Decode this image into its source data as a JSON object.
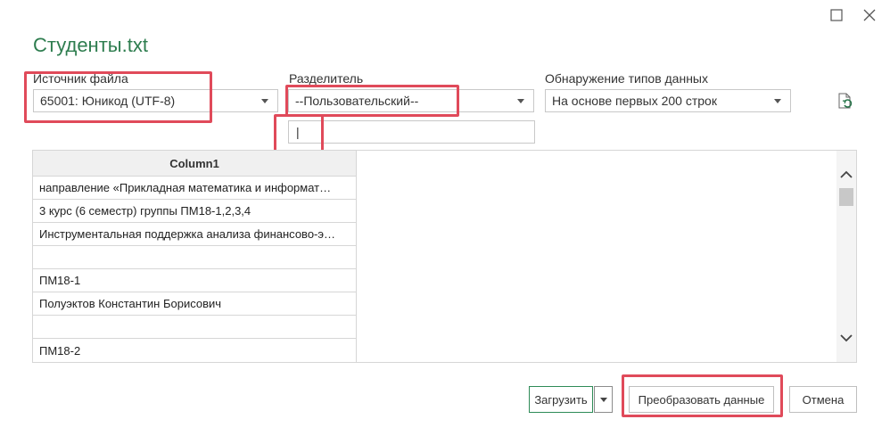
{
  "window": {
    "maximize_icon": "maximize-icon",
    "close_icon": "close-icon"
  },
  "dialog_title": "Студенты.txt",
  "file_origin": {
    "label": "Источник файла",
    "value": "65001: Юникод (UTF-8)"
  },
  "delimiter": {
    "label": "Разделитель",
    "value": "--Пользовательский--",
    "custom_value": "|"
  },
  "type_detection": {
    "label": "Обнаружение типов данных",
    "value": "На основе первых 200 строк"
  },
  "refresh_icon": "refresh-file-icon",
  "preview": {
    "column_header": "Column1",
    "rows": [
      "направление «Прикладная математика и информат…",
      "3 курс (6 семестр) группы ПМ18-1,2,3,4",
      "Инструментальная поддержка анализа финансово-э…",
      "",
      "ПМ18-1",
      "Полуэктов Константин Борисович",
      "",
      "ПМ18-2"
    ]
  },
  "buttons": {
    "load": "Загрузить",
    "transform": "Преобразовать данные",
    "cancel": "Отмена"
  },
  "colors": {
    "accent": "#217346",
    "highlight": "#e04a5a"
  }
}
